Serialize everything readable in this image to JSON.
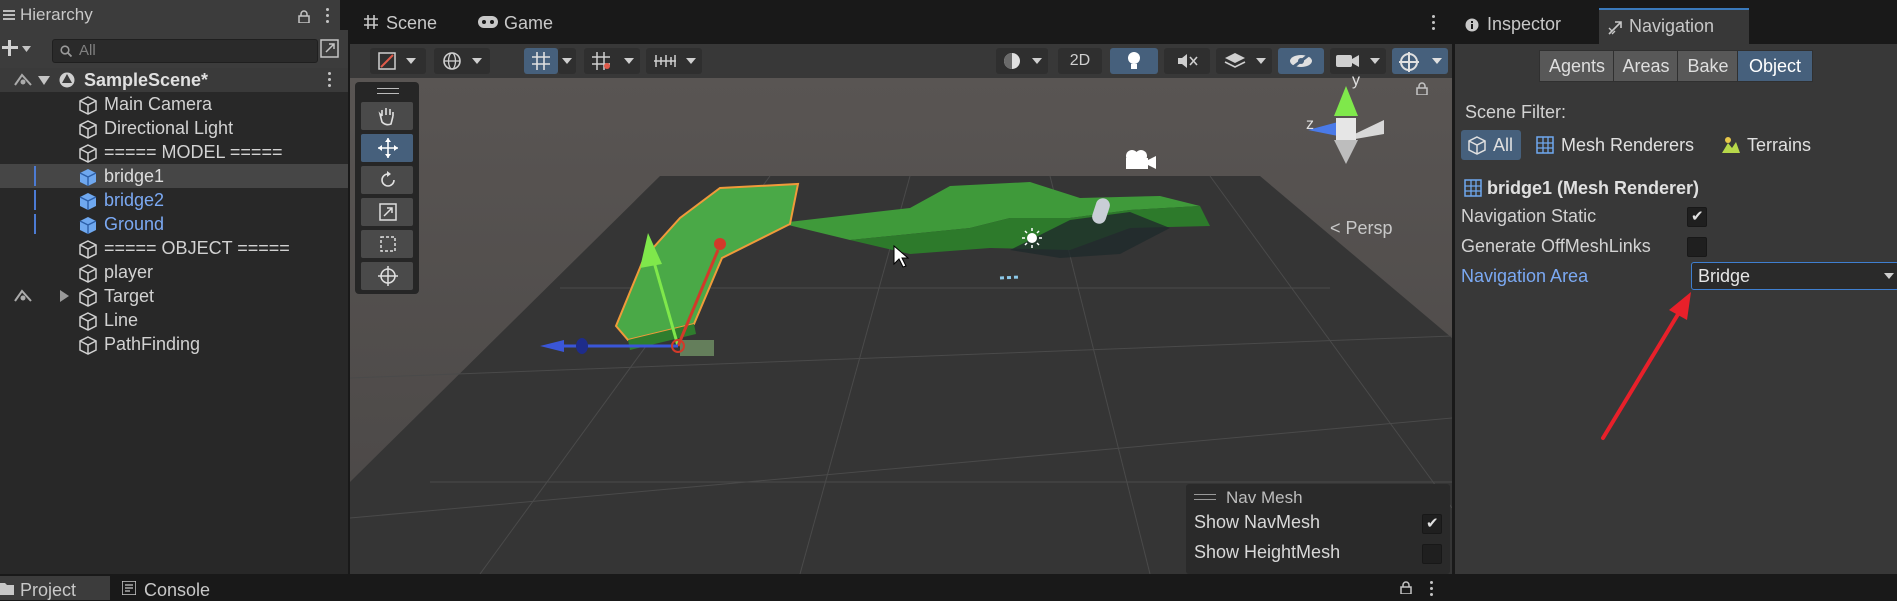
{
  "hierarchy": {
    "tab_label": "Hierarchy",
    "search_placeholder": "All",
    "scene_name": "SampleScene*",
    "items": [
      {
        "label": "Main Camera"
      },
      {
        "label": "Directional Light"
      },
      {
        "label": "===== MODEL ====="
      },
      {
        "label": "bridge1"
      },
      {
        "label": "bridge2"
      },
      {
        "label": "Ground"
      },
      {
        "label": "===== OBJECT ====="
      },
      {
        "label": "player"
      },
      {
        "label": "Target"
      },
      {
        "label": "Line"
      },
      {
        "label": "PathFinding"
      }
    ]
  },
  "scene": {
    "tab_scene": "Scene",
    "tab_game": "Game",
    "btn_2d": "2D",
    "persp_label": "< Persp",
    "gizmo_y": "y",
    "gizmo_z": "z",
    "navmesh_overlay": {
      "title": "Nav Mesh",
      "show_navmesh": "Show NavMesh",
      "show_heightmesh": "Show HeightMesh",
      "show_navmesh_checked": true,
      "show_heightmesh_checked": false
    }
  },
  "inspector": {
    "tab_inspector": "Inspector",
    "tab_navigation": "Navigation",
    "segments": [
      "Agents",
      "Areas",
      "Bake",
      "Object"
    ],
    "active_segment": "Object",
    "scene_filter_label": "Scene Filter:",
    "filters": {
      "all": "All",
      "mesh_renderers": "Mesh Renderers",
      "terrains": "Terrains"
    },
    "object_title": "bridge1 (Mesh Renderer)",
    "navigation_static_label": "Navigation Static",
    "navigation_static_checked": true,
    "generate_offmesh_label": "Generate OffMeshLinks",
    "generate_offmesh_checked": false,
    "navigation_area_label": "Navigation Area",
    "navigation_area_value": "Bridge"
  },
  "bottom": {
    "tab_project": "Project",
    "tab_console": "Console"
  },
  "colors": {
    "accent_blue": "#46607c",
    "link_blue": "#7ba9f3",
    "annotation_red": "#e8202a",
    "bridge_green": "#3f9a3a"
  }
}
